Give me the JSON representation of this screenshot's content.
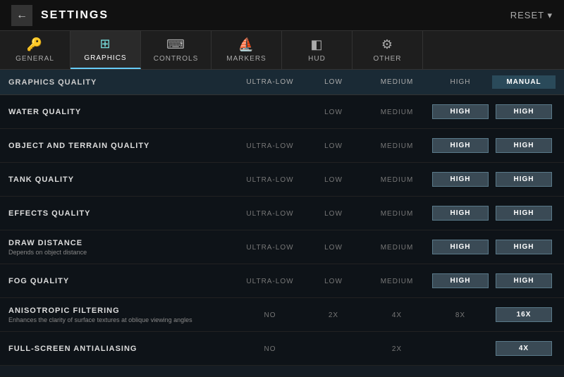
{
  "titleBar": {
    "back_label": "←",
    "title": "SETTINGS",
    "reset_label": "RESET ▾"
  },
  "tabs": [
    {
      "id": "general",
      "label": "GENERAL",
      "icon": "🔑",
      "active": false
    },
    {
      "id": "graphics",
      "label": "GRAPHICS",
      "icon": "⊞",
      "active": true
    },
    {
      "id": "controls",
      "label": "CONTROLS",
      "icon": "⌨",
      "active": false
    },
    {
      "id": "markers",
      "label": "MARKERS",
      "icon": "⛵",
      "active": false
    },
    {
      "id": "hud",
      "label": "HUD",
      "icon": "◧",
      "active": false
    },
    {
      "id": "other",
      "label": "OTHER",
      "icon": "⚙",
      "active": false
    }
  ],
  "qualityHeader": {
    "label": "GRAPHICS QUALITY",
    "columns": [
      "ULTRA-LOW",
      "LOW",
      "MEDIUM",
      "HIGH",
      "MANUAL"
    ],
    "active": "MANUAL"
  },
  "settings": [
    {
      "name": "WATER QUALITY",
      "sub": "",
      "options": [
        "LOW",
        "MEDIUM",
        "HIGH"
      ],
      "selected": "HIGH",
      "offset": 2
    },
    {
      "name": "OBJECT AND TERRAIN QUALITY",
      "sub": "",
      "options": [
        "ULTRA-LOW",
        "LOW",
        "MEDIUM",
        "HIGH"
      ],
      "selected": "HIGH",
      "offset": 1
    },
    {
      "name": "TANK QUALITY",
      "sub": "",
      "options": [
        "ULTRA-LOW",
        "LOW",
        "MEDIUM",
        "HIGH"
      ],
      "selected": "HIGH",
      "offset": 1
    },
    {
      "name": "EFFECTS QUALITY",
      "sub": "",
      "options": [
        "ULTRA-LOW",
        "LOW",
        "MEDIUM",
        "HIGH"
      ],
      "selected": "HIGH",
      "offset": 1
    },
    {
      "name": "DRAW DISTANCE",
      "sub": "Depends on object distance",
      "options": [
        "ULTRA-LOW",
        "LOW",
        "MEDIUM",
        "HIGH"
      ],
      "selected": "HIGH",
      "offset": 1
    },
    {
      "name": "FOG QUALITY",
      "sub": "",
      "options": [
        "ULTRA-LOW",
        "LOW",
        "MEDIUM",
        "HIGH"
      ],
      "selected": "HIGH",
      "offset": 1
    },
    {
      "name": "ANISOTROPIC FILTERING",
      "sub": "Enhances the clarity of surface textures at oblique viewing angles",
      "options": [
        "NO",
        "2X",
        "4X",
        "8X",
        "16X"
      ],
      "selected": "16X",
      "offset": 0
    },
    {
      "name": "FULL-SCREEN ANTIALIASING",
      "sub": "",
      "options": [
        "NO",
        "2X",
        "4X"
      ],
      "selected": "4X",
      "offset": 2
    }
  ],
  "colors": {
    "active_bg": "#2a4555",
    "selected_bg": "#3a4a55",
    "header_bg": "#1a2a35"
  }
}
